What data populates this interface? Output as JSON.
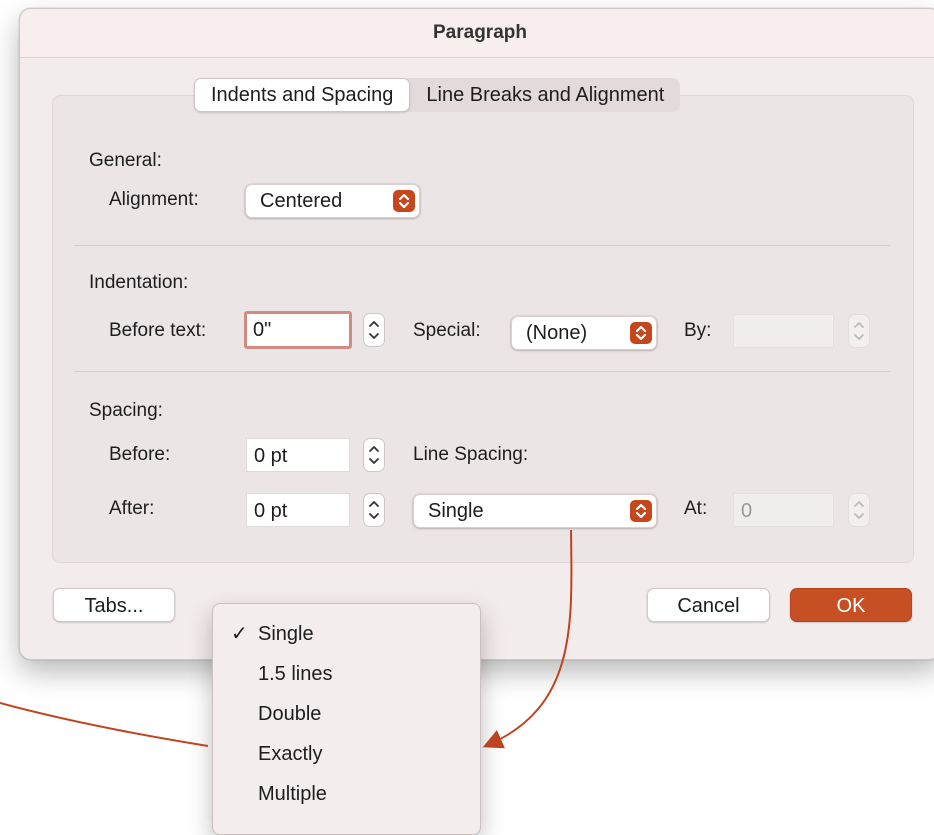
{
  "dialog": {
    "title": "Paragraph"
  },
  "tabs": [
    {
      "label": "Indents and Spacing",
      "active": true
    },
    {
      "label": "Line Breaks and Alignment",
      "active": false
    }
  ],
  "general": {
    "heading": "General:",
    "alignment_label": "Alignment:",
    "alignment_value": "Centered"
  },
  "indentation": {
    "heading": "Indentation:",
    "before_text_label": "Before text:",
    "before_text_value": "0\"",
    "special_label": "Special:",
    "special_value": "(None)",
    "by_label": "By:",
    "by_value": ""
  },
  "spacing": {
    "heading": "Spacing:",
    "before_label": "Before:",
    "before_value": "0 pt",
    "after_label": "After:",
    "after_value": "0 pt",
    "line_spacing_label": "Line Spacing:",
    "line_spacing_value": "Single",
    "at_label": "At:",
    "at_value": "0"
  },
  "buttons": {
    "tabs": "Tabs...",
    "cancel": "Cancel",
    "ok": "OK"
  },
  "line_spacing_menu": {
    "check": "✓",
    "items": [
      "Single",
      "1.5 lines",
      "Double",
      "Exactly",
      "Multiple"
    ],
    "selected": "Single"
  },
  "colors": {
    "accent": "#c74f24",
    "annotation_arrow": "#c0431f",
    "dialog_bg": "#f3ecec"
  },
  "icons": {
    "popup_arrows": "chevron-up-down-icon",
    "stepper": "stepper-arrows-icon",
    "checkmark": "checkmark-icon"
  }
}
